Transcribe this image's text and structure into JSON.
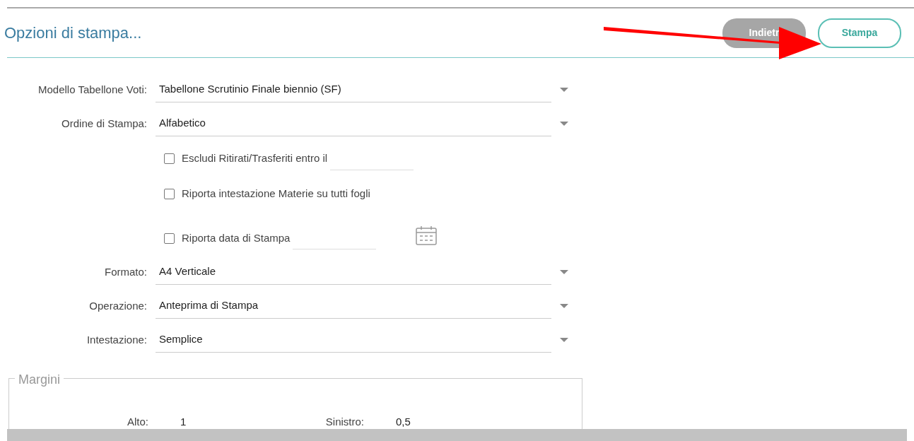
{
  "header": {
    "title": "Opzioni di stampa...",
    "buttons": [
      {
        "label": "Indietr",
        "kind": "secondary"
      },
      {
        "label": "Stampa",
        "kind": "primary"
      }
    ]
  },
  "form": [
    {
      "kind": "select",
      "label": "Modello Tabellone Voti:",
      "value": "Tabellone Scrutinio Finale biennio (SF)"
    },
    {
      "kind": "select",
      "label": "Ordine di Stampa:",
      "value": "Alfabetico"
    },
    {
      "kind": "checkbox",
      "label": "Escludi Ritirati/Trasferiti entro il",
      "checked": false,
      "date_field": true,
      "calendar": false
    },
    {
      "kind": "checkbox",
      "label": "Riporta intestazione Materie su tutti fogli",
      "checked": false,
      "date_field": false,
      "calendar": false
    },
    {
      "kind": "checkbox",
      "label": "Riporta data di Stampa",
      "checked": false,
      "date_field": true,
      "calendar": true
    },
    {
      "kind": "select",
      "label": "Formato:",
      "value": "A4 Verticale"
    },
    {
      "kind": "select",
      "label": "Operazione:",
      "value": "Anteprima di Stampa"
    },
    {
      "kind": "select",
      "label": "Intestazione:",
      "value": "Semplice"
    }
  ],
  "margins": {
    "title": "Margini",
    "fields": [
      {
        "label": "Alto:",
        "value": "1"
      },
      {
        "label": "Sinistro:",
        "value": "0,5"
      }
    ]
  }
}
